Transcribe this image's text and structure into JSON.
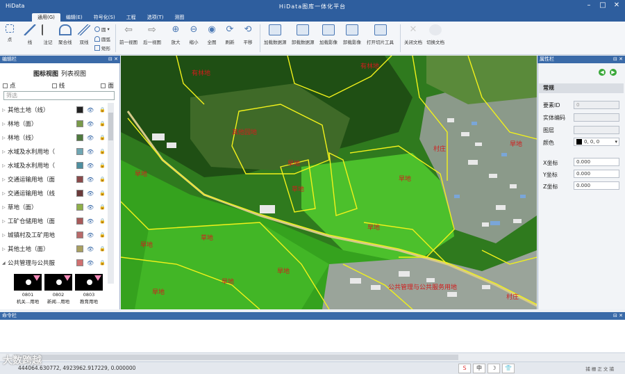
{
  "titlebar": {
    "app_name": "HiData",
    "window_title": "HiData图库一体化平台"
  },
  "menu": [
    "通用(G)",
    "编辑(E)",
    "符号化(S)",
    "工程",
    "选项(T)",
    "测图"
  ],
  "ribbon": {
    "point": "点",
    "line": "线",
    "note": "注记",
    "polyline": "聚合线",
    "double_line": "双线",
    "circle": "圆",
    "arc": "圆弧",
    "rect": "矩形",
    "prev_view": "前一视图",
    "next_view": "后一视图",
    "zoom_in": "放大",
    "zoom_out": "缩小",
    "full_view": "全图",
    "refresh": "刷新",
    "pan": "平移",
    "load_data": "加载数据源",
    "unload_data": "卸载数据源",
    "load_image": "加载影像",
    "unload_image": "卸载影像",
    "open_tiles": "打开切片工具",
    "close_doc": "关闭文档",
    "switch_doc": "切换文档"
  },
  "left_panel": {
    "title": "编辑栏",
    "tab_icon": "图标视图",
    "tab_list": "列表视图",
    "filter_point": "点",
    "filter_line": "线",
    "filter_area": "面",
    "filter_placeholder": "筛选",
    "layers": [
      {
        "name": "其他土地（线）",
        "color": "#222222"
      },
      {
        "name": "林地（面）",
        "color": "#7a9a4a"
      },
      {
        "name": "林地（线）",
        "color": "#4f7a3e"
      },
      {
        "name": "水域及水利用地（",
        "color": "#6fa6b3"
      },
      {
        "name": "水域及水利用地（",
        "color": "#4f8fa0"
      },
      {
        "name": "交通运输用地（面",
        "color": "#8a4a4a"
      },
      {
        "name": "交通运输用地（线",
        "color": "#6a3a3a"
      },
      {
        "name": "草地（面）",
        "color": "#8fb04a"
      },
      {
        "name": "工矿仓储用地（面",
        "color": "#a85a5a"
      },
      {
        "name": "城镇村及工矿用地",
        "color": "#b86a6a"
      },
      {
        "name": "其他土地（面）",
        "color": "#a9a060"
      },
      {
        "name": "公共管理与公共服",
        "color": "#d07070"
      }
    ],
    "symbols": [
      {
        "code": "0801",
        "label": "机关...用地"
      },
      {
        "code": "0802",
        "label": "新闻...用地"
      },
      {
        "code": "0803",
        "label": "教育用地"
      }
    ]
  },
  "map": {
    "labels": [
      "有林地",
      "有林地",
      "其他园地",
      "草地",
      "草地",
      "旱地",
      "旱地",
      "旱地",
      "旱地",
      "旱地",
      "旱地",
      "旱地",
      "旱地",
      "旱地",
      "村庄",
      "公共管理与公共服务用地",
      "村庄"
    ]
  },
  "right_panel": {
    "title": "属性栏",
    "section": "常规",
    "feature_id_label": "要素ID",
    "feature_id": "0",
    "entity_code_label": "实体编码",
    "entity_code": "",
    "layer_label": "图层",
    "layer": "",
    "color_label": "颜色",
    "color_value": "0, 0, 0",
    "x_label": "X坐标",
    "x": "0.000",
    "y_label": "Y坐标",
    "y": "0.000",
    "z_label": "Z坐标",
    "z": "0.000"
  },
  "command": {
    "title": "命令栏"
  },
  "status": {
    "coords": "444064.630772, 4923962.917229, 0.000000",
    "ime": [
      "S",
      "中",
      "☽",
      "👕"
    ],
    "right": "捕 栅 正 文 捕",
    "watermark": "大数跨越"
  }
}
